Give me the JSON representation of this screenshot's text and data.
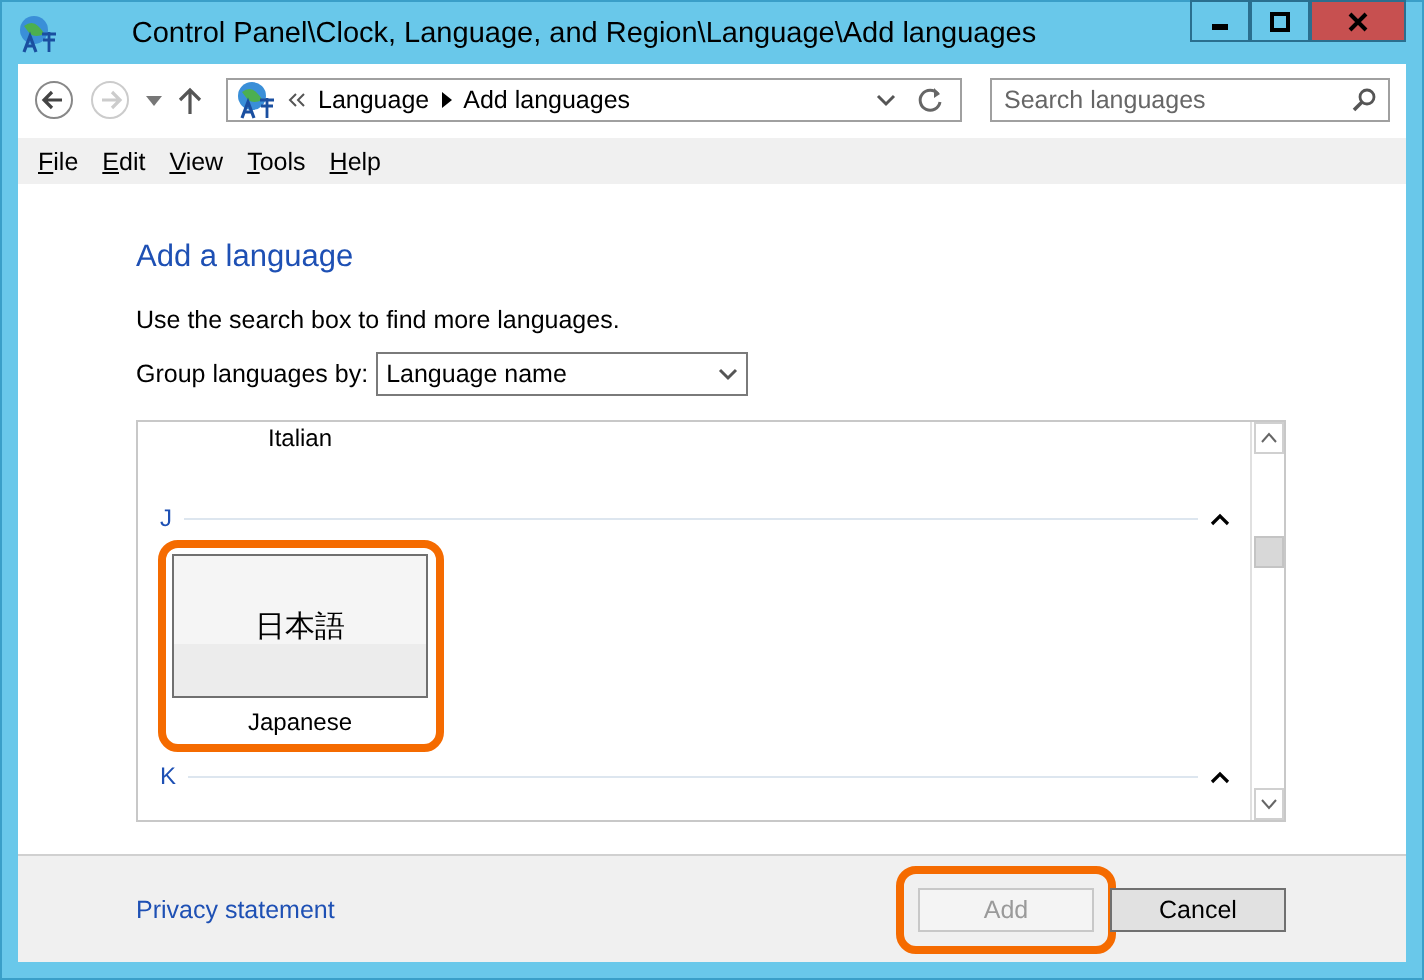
{
  "window": {
    "title": "Control Panel\\Clock, Language, and Region\\Language\\Add languages"
  },
  "nav": {
    "breadcrumb": [
      "Language",
      "Add languages"
    ],
    "search": {
      "placeholder": "Search languages"
    }
  },
  "menu": [
    "File",
    "Edit",
    "View",
    "Tools",
    "Help"
  ],
  "heading": "Add a language",
  "hint": "Use the search box to find more languages.",
  "group_by": {
    "label": "Group languages by:",
    "value": "Language name"
  },
  "list": [
    {
      "kind": "label",
      "text": "Italian"
    },
    {
      "kind": "group",
      "letter": "J",
      "expanded": true
    },
    {
      "kind": "tile",
      "native": "日本語",
      "name": "Japanese",
      "highlighted": true
    },
    {
      "kind": "group",
      "letter": "K",
      "expanded": true
    }
  ],
  "footer": {
    "link": "Privacy statement",
    "buttons": [
      {
        "label": "Add",
        "disabled": true,
        "highlighted": true
      },
      {
        "label": "Cancel",
        "disabled": false,
        "highlighted": false
      }
    ]
  }
}
